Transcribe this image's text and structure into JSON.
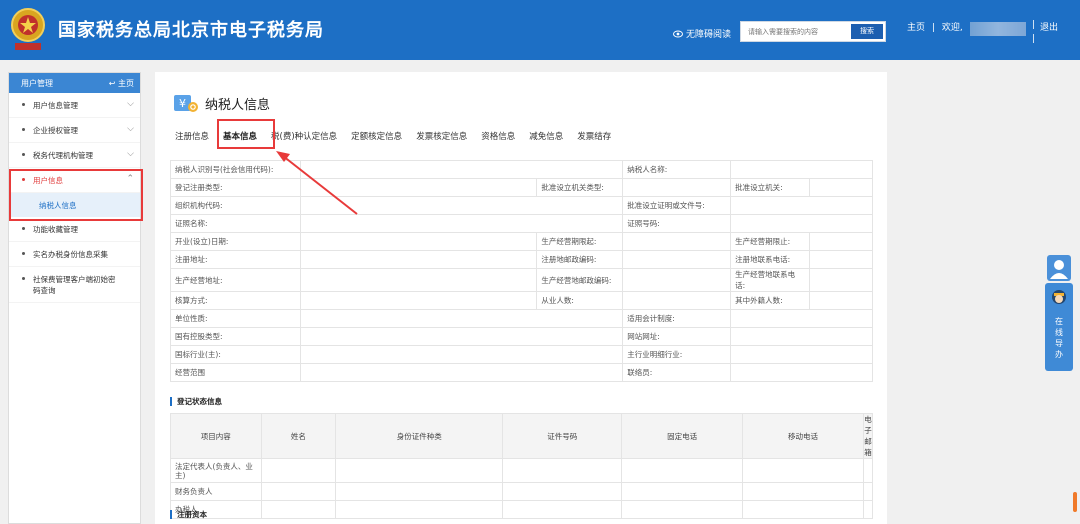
{
  "header": {
    "title": "国家税务总局北京市电子税务局",
    "access_label": "无障碍阅读",
    "search_placeholder": "请输入需要搜索的内容",
    "search_button": "搜索",
    "home_link": "主页",
    "welcome": "欢迎,",
    "logout": "退出",
    "separator": "|"
  },
  "sidebar": {
    "head_label": "用户管理",
    "head_home": "主页",
    "items": [
      {
        "label": "用户信息管理"
      },
      {
        "label": "企业授权管理"
      },
      {
        "label": "税务代理机构管理"
      },
      {
        "label": "用户信息"
      },
      {
        "label": "功能收藏管理"
      },
      {
        "label": "实名办税身份信息采集"
      },
      {
        "label": "社保费管理客户端初始密码查询"
      }
    ],
    "sub_item": "纳税人信息"
  },
  "main": {
    "title": "纳税人信息",
    "tabs": [
      "注册信息",
      "基本信息",
      "税(费)种认定信息",
      "定额核定信息",
      "发票核定信息",
      "资格信息",
      "减免信息",
      "发票结存"
    ],
    "info_rows": [
      [
        "纳税人识别号(社会信用代码):",
        "",
        "",
        "",
        "纳税人名称:",
        "",
        "",
        ""
      ],
      [
        "登记注册类型:",
        "",
        "批准设立机关类型:",
        "",
        "",
        "",
        "批准设立机关:",
        ""
      ],
      [
        "组织机构代码:",
        "",
        "",
        "",
        "批准设立证明或文件号:",
        "",
        "",
        ""
      ],
      [
        "证照名称:",
        "",
        "",
        "",
        "证照号码:",
        "",
        "",
        ""
      ],
      [
        "开业(设立)日期:",
        "",
        "生产经营期限起:",
        "",
        "",
        "",
        "生产经营期限止:",
        ""
      ],
      [
        "注册地址:",
        "",
        "注册地邮政编码:",
        "",
        "",
        "",
        "注册地联系电话:",
        ""
      ],
      [
        "生产经营地址:",
        "",
        "生产经营地邮政编码:",
        "",
        "",
        "",
        "生产经营地联系电话:",
        ""
      ],
      [
        "核算方式:",
        "",
        "从业人数:",
        "",
        "",
        "",
        "其中外籍人数:",
        ""
      ],
      [
        "单位性质:",
        "",
        "",
        "",
        "适用会计制度:",
        "",
        "",
        ""
      ],
      [
        "国有控股类型:",
        "",
        "",
        "",
        "网站网址:",
        "",
        "",
        ""
      ],
      [
        "国标行业(主):",
        "",
        "",
        "",
        "主行业明细行业:",
        "",
        "",
        ""
      ],
      [
        "经营范围",
        "",
        "",
        "",
        "联络员:",
        "",
        "",
        ""
      ]
    ],
    "section_register_status": "登记状态信息",
    "contact_headers": [
      "项目内容",
      "姓名",
      "身份证件种类",
      "证件号码",
      "固定电话",
      "移动电话",
      "电子邮箱"
    ],
    "contact_rows": [
      "法定代表人(负责人、业主)",
      "财务负责人",
      "办税人"
    ],
    "section_capital": "注册资本"
  },
  "helper": {
    "label": "在线导办"
  }
}
